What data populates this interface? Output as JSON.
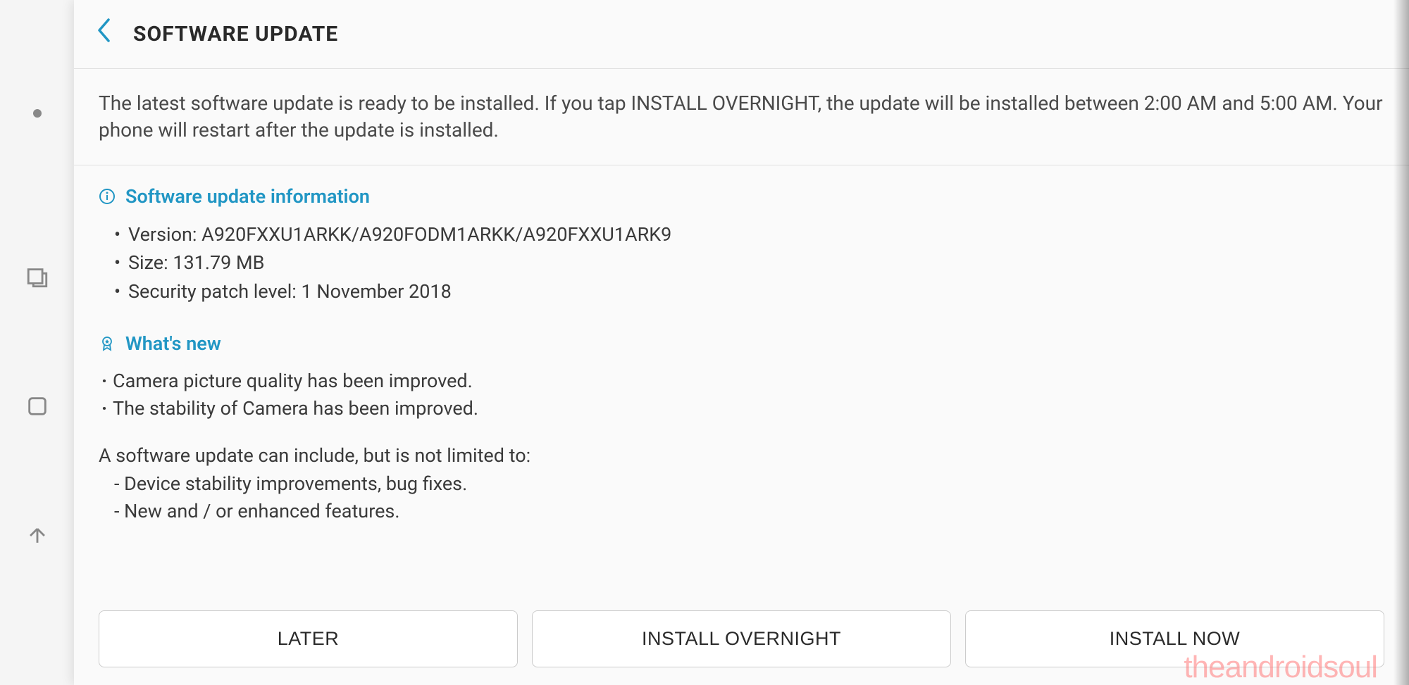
{
  "header": {
    "title": "SOFTWARE UPDATE"
  },
  "intro": "The latest software update is ready to be installed. If you tap INSTALL OVERNIGHT, the update will be installed between 2:00 AM and 5:00 AM. Your phone will restart after the update is installed.",
  "info_section": {
    "title": "Software update information",
    "version_label": "Version: A920FXXU1ARKK/A920FODM1ARKK/A920FXXU1ARK9",
    "size_label": "Size: 131.79 MB",
    "security_label": "Security patch level: 1 November 2018"
  },
  "whatsnew_section": {
    "title": "What's new",
    "items": [
      "Camera picture quality has been improved.",
      "The stability of Camera has been improved."
    ]
  },
  "footnote": {
    "lead": "A software update can include, but is not limited to:",
    "items": [
      " - Device stability improvements, bug fixes.",
      " - New and / or enhanced features."
    ]
  },
  "buttons": {
    "later": "LATER",
    "overnight": "INSTALL OVERNIGHT",
    "now": "INSTALL NOW"
  },
  "watermark": "theandroidsoul"
}
